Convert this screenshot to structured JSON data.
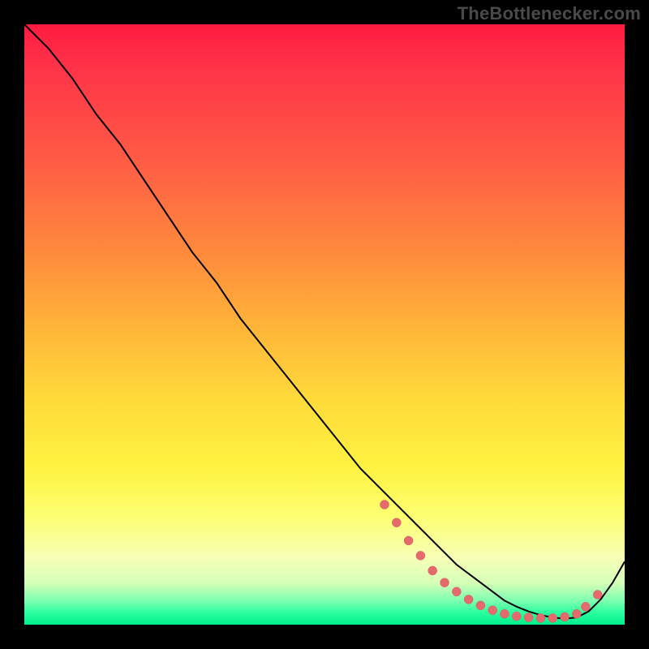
{
  "watermark": "TheBottlenecker.com",
  "chart_data": {
    "type": "line",
    "title": "",
    "xlabel": "",
    "ylabel": "",
    "xlim": [
      0,
      100
    ],
    "ylim": [
      0,
      100
    ],
    "grid": false,
    "legend": false,
    "series": [
      {
        "name": "curve",
        "x": [
          0,
          4,
          8,
          12,
          16,
          20,
          24,
          28,
          32,
          36,
          40,
          44,
          48,
          52,
          56,
          60,
          64,
          68,
          72,
          76,
          80,
          82,
          84,
          86,
          88,
          90,
          92,
          94,
          96,
          98,
          100
        ],
        "y": [
          100,
          96,
          91,
          85,
          80,
          74,
          68,
          62,
          57,
          51,
          46,
          41,
          36,
          31,
          26,
          22,
          18,
          14,
          10,
          7,
          4,
          3,
          2.2,
          1.6,
          1.2,
          1,
          1.2,
          2.2,
          4.2,
          7,
          10.5
        ]
      }
    ],
    "markers": [
      {
        "x": 60,
        "y": 20
      },
      {
        "x": 62,
        "y": 17
      },
      {
        "x": 64,
        "y": 14
      },
      {
        "x": 66,
        "y": 11.5
      },
      {
        "x": 68,
        "y": 9
      },
      {
        "x": 70,
        "y": 7
      },
      {
        "x": 72,
        "y": 5.5
      },
      {
        "x": 74,
        "y": 4.2
      },
      {
        "x": 76,
        "y": 3.2
      },
      {
        "x": 78,
        "y": 2.4
      },
      {
        "x": 80,
        "y": 1.8
      },
      {
        "x": 82,
        "y": 1.4
      },
      {
        "x": 84,
        "y": 1.2
      },
      {
        "x": 86,
        "y": 1.1
      },
      {
        "x": 88,
        "y": 1.1
      },
      {
        "x": 90,
        "y": 1.3
      },
      {
        "x": 92,
        "y": 1.8
      },
      {
        "x": 93.5,
        "y": 3
      },
      {
        "x": 95.5,
        "y": 5
      }
    ],
    "background_gradient": {
      "top": "#ff1a3f",
      "mid_upper": "#ffb339",
      "mid": "#fff341",
      "mid_lower": "#f6ffb6",
      "bottom": "#00f08c"
    }
  }
}
